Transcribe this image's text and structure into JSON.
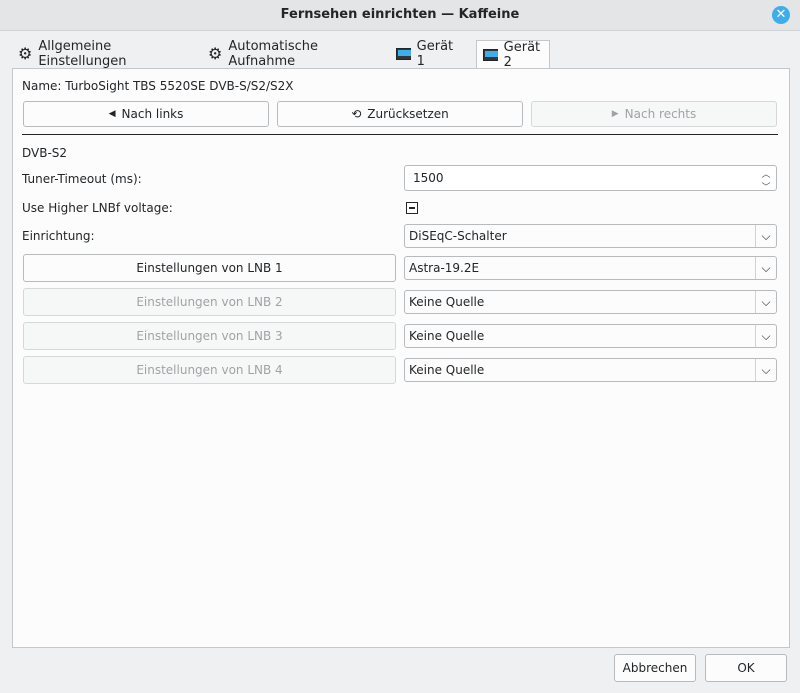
{
  "window": {
    "title": "Fernsehen einrichten — Kaffeine"
  },
  "tabs": [
    {
      "label": "Allgemeine Einstellungen",
      "icon": "gear-icon"
    },
    {
      "label": "Automatische Aufnahme",
      "icon": "gear-icon"
    },
    {
      "label": "Gerät 1",
      "icon": "tv-device-icon"
    },
    {
      "label": "Gerät 2",
      "icon": "tv-device-icon"
    }
  ],
  "device": {
    "name_label": "Name: TurboSight TBS 5520SE DVB-S/S2/S2X",
    "nav_left": "Nach links",
    "reset": "Zurücksetzen",
    "nav_right": "Nach rechts",
    "section": "DVB-S2",
    "tuner_timeout_label": "Tuner-Timeout (ms):",
    "tuner_timeout_value": "1500",
    "lnb_voltage_label": "Use Higher LNBf voltage:",
    "setup_label": "Einrichtung:",
    "setup_value": "DiSEqC-Schalter",
    "lnbs": [
      {
        "label": "Einstellungen von LNB 1",
        "source": "Astra-19.2E"
      },
      {
        "label": "Einstellungen von LNB 2",
        "source": "Keine Quelle"
      },
      {
        "label": "Einstellungen von LNB 3",
        "source": "Keine Quelle"
      },
      {
        "label": "Einstellungen von LNB 4",
        "source": "Keine Quelle"
      }
    ]
  },
  "footer": {
    "cancel": "Abbrechen",
    "ok": "OK"
  },
  "colors": {
    "accent": "#3daee9",
    "window_bg": "#eff0f1",
    "panel_bg": "#fcfcfc"
  }
}
